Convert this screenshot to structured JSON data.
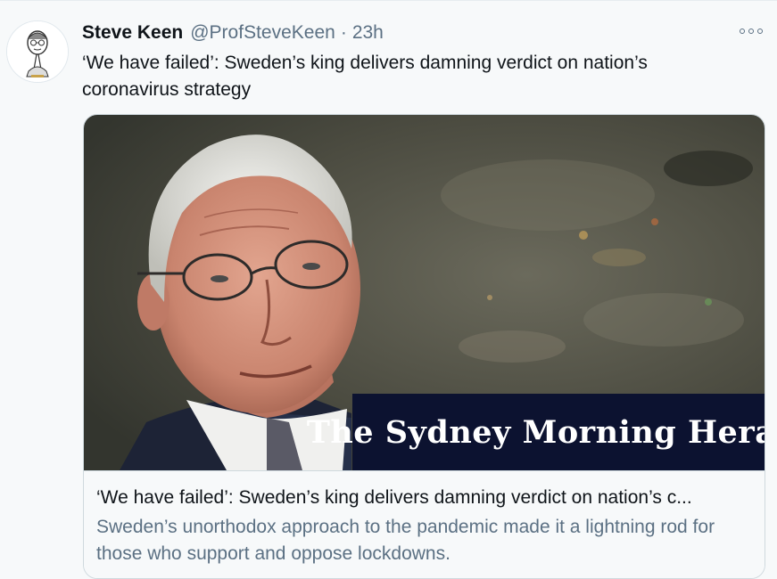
{
  "tweet": {
    "author_name": "Steve Keen",
    "author_handle": "@ProfSteveKeen",
    "separator": "·",
    "time": "23h",
    "text": "‘We have failed’: Sweden’s king delivers damning verdict on nation’s coronavirus strategy"
  },
  "card": {
    "image_caption": "The Sydney Morning Herald",
    "title": "‘We have failed’: Sweden’s king delivers damning verdict on nation’s c...",
    "description": "Sweden’s unorthodox approach to the pandemic made it a lightning rod for those who support and oppose lockdowns."
  },
  "icons": {
    "more": "more-options-icon",
    "avatar": "caricature-avatar"
  },
  "colors": {
    "text_primary": "#0f1419",
    "text_secondary": "#5b7083",
    "banner_bg": "#0c1230"
  }
}
